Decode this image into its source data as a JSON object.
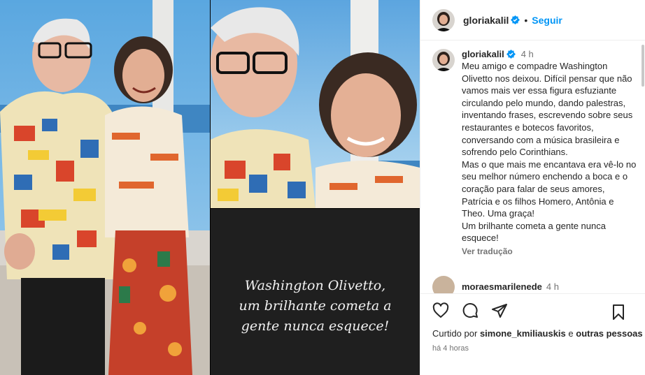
{
  "post": {
    "username": "gloriakalil",
    "follow_label": "Seguir",
    "separator": "•",
    "caption_time": "4 h",
    "caption_text": "Meu amigo e compadre Washington Olivetto nos deixou. Difícil pensar que não vamos mais ver essa figura esfuziante circulando pelo mundo, dando palestras, inventando frases, escrevendo sobre seus restaurantes e botecos favoritos, conversando com a música brasileira e sofrendo pelo Corinthians.\nMas o que mais me encantava era vê-lo no seu melhor número enchendo a boca e o coração para falar de seus amores, Patrícia e os filhos Homero, Antônia e Theo. Uma graça!\nUm brilhante cometa a gente nunca esquece!",
    "translate_label": "Ver tradução",
    "quote_card_text": "Washington Olivetto,\num brilhante cometa a\ngente nunca esquece!"
  },
  "comments": [
    {
      "username": "moraesmarilenede",
      "time": "4 h"
    }
  ],
  "likes": {
    "prefix": "Curtido por",
    "user": "simone_kmiliauskis",
    "suffix": "e",
    "others": "outras pessoas"
  },
  "posted_ago": "há 4 horas",
  "colors": {
    "accent": "#0095f6",
    "verified": "#0095f6",
    "muted": "#737373",
    "quote_bg": "#1f1f1f"
  },
  "icons": [
    "heart-icon",
    "comment-icon",
    "share-icon",
    "bookmark-icon",
    "verified-icon"
  ]
}
